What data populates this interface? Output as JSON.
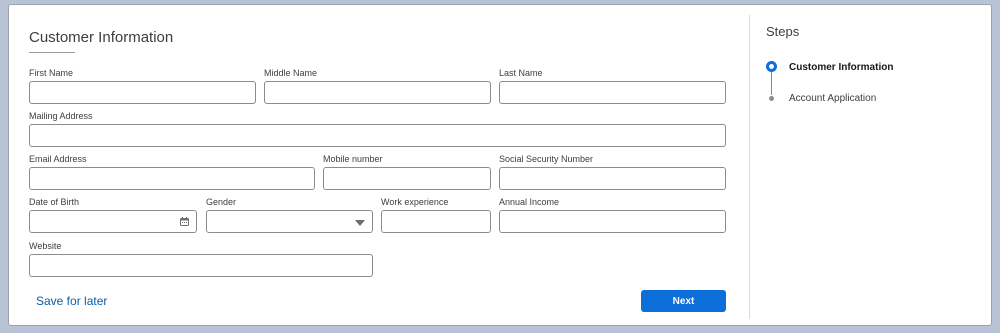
{
  "form": {
    "title": "Customer Information",
    "fields": {
      "first_name": {
        "label": "First Name",
        "value": ""
      },
      "middle_name": {
        "label": "Middle Name",
        "value": ""
      },
      "last_name": {
        "label": "Last Name",
        "value": ""
      },
      "mailing_address": {
        "label": "Mailing Address",
        "value": ""
      },
      "email": {
        "label": "Email Address",
        "value": ""
      },
      "mobile": {
        "label": "Mobile number",
        "value": ""
      },
      "ssn": {
        "label": "Social Security Number",
        "value": ""
      },
      "dob": {
        "label": "Date of Birth",
        "value": ""
      },
      "gender": {
        "label": "Gender",
        "value": ""
      },
      "work_experience": {
        "label": "Work experience",
        "value": ""
      },
      "annual_income": {
        "label": "Annual Income",
        "value": ""
      },
      "website": {
        "label": "Website",
        "value": ""
      }
    },
    "save_label": "Save for later",
    "next_label": "Next"
  },
  "steps": {
    "title": "Steps",
    "items": [
      {
        "label": "Customer Information",
        "active": true
      },
      {
        "label": "Account Application",
        "active": false
      }
    ]
  },
  "colors": {
    "accent": "#0b6ed9",
    "link": "#0b5cab",
    "background": "#b8c3d6"
  },
  "icons": {
    "dob": "calendar-icon",
    "gender": "chevron-down-icon"
  }
}
